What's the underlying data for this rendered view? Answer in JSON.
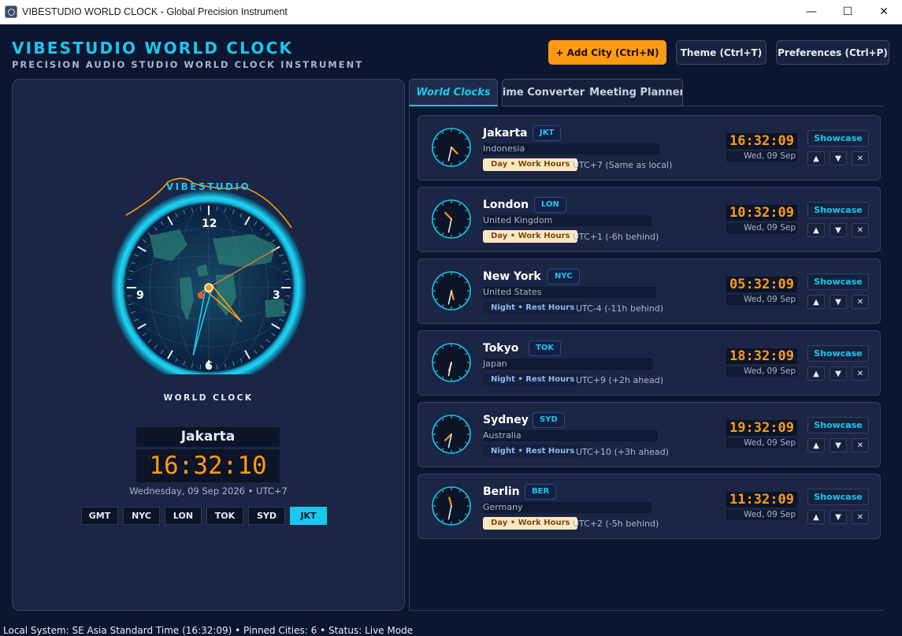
{
  "window": {
    "title": "VIBESTUDIO WORLD CLOCK - Global Precision Instrument",
    "app_icon": "clock-app-icon",
    "minimize": "—",
    "maximize": "☐",
    "close": "✕"
  },
  "header": {
    "title": "VIBESTUDIO WORLD CLOCK",
    "subtitle": "PRECISION AUDIO STUDIO WORLD CLOCK INSTRUMENT",
    "add_city": "+ Add City (Ctrl+N)",
    "theme": "Theme (Ctrl+T)",
    "preferences": "Preferences (Ctrl+P)"
  },
  "colors": {
    "accent": "#18c8ee",
    "orange": "#ff9a14",
    "background": "#0d1630",
    "panel": "#1b2644"
  },
  "main_clock": {
    "brand": "VIBESTUDIO",
    "footer": "WORLD CLOCK",
    "numerals": {
      "n12": "12",
      "n3": "3",
      "n6": "6",
      "n9": "9"
    },
    "hours": 16,
    "minutes": 32,
    "seconds": 10
  },
  "selected": {
    "city": "Jakarta",
    "time": "16:32:10",
    "date": "Wednesday, 09 Sep 2026 • UTC+7"
  },
  "quick_cities": [
    {
      "label": "GMT",
      "active": false
    },
    {
      "label": "NYC",
      "active": false
    },
    {
      "label": "LON",
      "active": false
    },
    {
      "label": "TOK",
      "active": false
    },
    {
      "label": "SYD",
      "active": false
    },
    {
      "label": "JKT",
      "active": true
    }
  ],
  "tabs": {
    "world_clocks": "World Clocks",
    "time_converter": "Time Converter",
    "meeting_planner": "Meeting Planner"
  },
  "common": {
    "showcase": "Showcase",
    "move_up": "▲",
    "move_down": "▼",
    "remove": "✕"
  },
  "cities": [
    {
      "city": "Jakarta",
      "code": "JKT",
      "country": "Indonesia",
      "status": "Day • Work Hours",
      "is_day": true,
      "offset": "UTC+7 (Same as local)",
      "time": "16:32:09",
      "date": "Wed, 09 Sep",
      "hours": 16,
      "minutes": 32,
      "seconds": 9
    },
    {
      "city": "London",
      "code": "LON",
      "country": "United Kingdom",
      "status": "Day • Work Hours",
      "is_day": true,
      "offset": "UTC+1 (-6h behind)",
      "time": "10:32:09",
      "date": "Wed, 09 Sep",
      "hours": 10,
      "minutes": 32,
      "seconds": 9
    },
    {
      "city": "New York",
      "code": "NYC",
      "country": "United States",
      "status": "Night • Rest Hours",
      "is_day": false,
      "offset": "UTC-4 (-11h behind)",
      "time": "05:32:09",
      "date": "Wed, 09 Sep",
      "hours": 5,
      "minutes": 32,
      "seconds": 9
    },
    {
      "city": "Tokyo",
      "code": "TOK",
      "country": "Japan",
      "status": "Night • Rest Hours",
      "is_day": false,
      "offset": "UTC+9 (+2h ahead)",
      "time": "18:32:09",
      "date": "Wed, 09 Sep",
      "hours": 18,
      "minutes": 32,
      "seconds": 9
    },
    {
      "city": "Sydney",
      "code": "SYD",
      "country": "Australia",
      "status": "Night • Rest Hours",
      "is_day": false,
      "offset": "UTC+10 (+3h ahead)",
      "time": "19:32:09",
      "date": "Wed, 09 Sep",
      "hours": 19,
      "minutes": 32,
      "seconds": 9
    },
    {
      "city": "Berlin",
      "code": "BER",
      "country": "Germany",
      "status": "Day • Work Hours",
      "is_day": true,
      "offset": "UTC+2 (-5h behind)",
      "time": "11:32:09",
      "date": "Wed, 09 Sep",
      "hours": 11,
      "minutes": 32,
      "seconds": 9
    }
  ],
  "status_bar": "Local System: SE Asia Standard Time (16:32:09) • Pinned Cities: 6 • Status: Live Mode"
}
